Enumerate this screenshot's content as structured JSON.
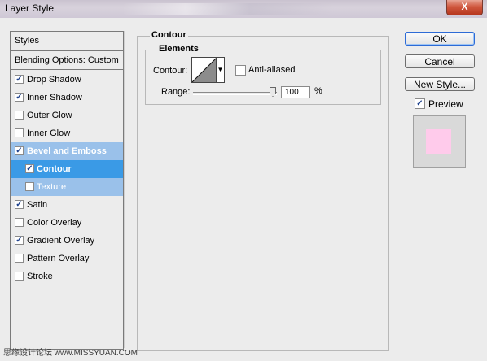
{
  "window": {
    "title": "Layer Style",
    "close_label": "X"
  },
  "styles_panel": {
    "header": "Styles",
    "blending_options": "Blending Options: Custom",
    "items": [
      {
        "label": "Drop Shadow",
        "checked": true
      },
      {
        "label": "Inner Shadow",
        "checked": true
      },
      {
        "label": "Outer Glow",
        "checked": false
      },
      {
        "label": "Inner Glow",
        "checked": false
      },
      {
        "label": "Bevel and Emboss",
        "checked": true
      },
      {
        "label": "Contour",
        "checked": true
      },
      {
        "label": "Texture",
        "checked": false
      },
      {
        "label": "Satin",
        "checked": true
      },
      {
        "label": "Color Overlay",
        "checked": false
      },
      {
        "label": "Gradient Overlay",
        "checked": true
      },
      {
        "label": "Pattern Overlay",
        "checked": false
      },
      {
        "label": "Stroke",
        "checked": false
      }
    ],
    "check_glyph": "✓"
  },
  "contour": {
    "group_title": "Contour",
    "elements_title": "Elements",
    "contour_label": "Contour:",
    "dropdown_glyph": "▼",
    "anti_aliased_label": "Anti-aliased",
    "anti_aliased_checked": false,
    "range_label": "Range:",
    "range_value": "100",
    "range_unit": "%"
  },
  "buttons": {
    "ok": "OK",
    "cancel": "Cancel",
    "new_style": "New Style..."
  },
  "preview": {
    "label": "Preview",
    "checked": true,
    "swatch_color": "#ffcbeb"
  },
  "watermark": "思缘设计论坛 www.MISSYUAN.COM"
}
